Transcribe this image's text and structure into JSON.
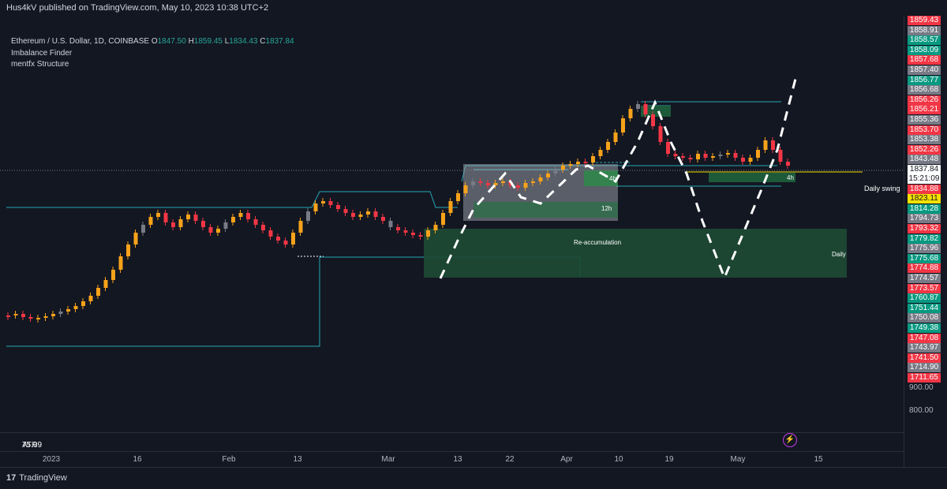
{
  "header": {
    "published": "Hus4kV published on TradingView.com, May 10, 2023 10:38 UTC+2"
  },
  "legend": {
    "symbol": "Ethereum / U.S. Dollar, 1D, COINBASE",
    "open_label": "O",
    "open": "1847.50",
    "high_label": "H",
    "high": "1859.45",
    "low_label": "L",
    "low": "1834.43",
    "close_label": "C",
    "close": "1837.84",
    "indicators": [
      "Imbalance Finder",
      "mentfx Structure"
    ]
  },
  "annotations": {
    "daily_swing": "Daily swing",
    "reaccumulation": "Re-accumulation",
    "tag_4h_a": "4h",
    "tag_4h_b": "4h",
    "tag_12h": "12h",
    "tag_daily": "Daily"
  },
  "price_axis": {
    "labels": [
      {
        "value": "1859.43",
        "color": "#f23645"
      },
      {
        "value": "1858.91",
        "color": "#787b86"
      },
      {
        "value": "1858.57",
        "color": "#089981"
      },
      {
        "value": "1858.09",
        "color": "#089981"
      },
      {
        "value": "1857.68",
        "color": "#f23645"
      },
      {
        "value": "1857.40",
        "color": "#787b86"
      },
      {
        "value": "1856.77",
        "color": "#089981"
      },
      {
        "value": "1856.68",
        "color": "#787b86"
      },
      {
        "value": "1856.26",
        "color": "#f23645"
      },
      {
        "value": "1856.21",
        "color": "#f23645"
      },
      {
        "value": "1855.36",
        "color": "#787b86"
      },
      {
        "value": "1853.70",
        "color": "#f23645"
      },
      {
        "value": "1853.38",
        "color": "#787b86"
      },
      {
        "value": "1852.26",
        "color": "#f23645"
      },
      {
        "value": "1843.48",
        "color": "#787b86"
      },
      {
        "value": "1837.84",
        "color": "#ffffff"
      },
      {
        "value": "15:21:09",
        "color": "#ffffff"
      },
      {
        "value": "1834.88",
        "color": "#f23645"
      },
      {
        "value": "1823.11",
        "color": "#f5e100"
      },
      {
        "value": "1814.28",
        "color": "#089981"
      },
      {
        "value": "1794.73",
        "color": "#787b86"
      },
      {
        "value": "1793.32",
        "color": "#f23645"
      },
      {
        "value": "1779.82",
        "color": "#089981"
      },
      {
        "value": "1775.96",
        "color": "#787b86"
      },
      {
        "value": "1775.68",
        "color": "#089981"
      },
      {
        "value": "1774.88",
        "color": "#f23645"
      },
      {
        "value": "1774.57",
        "color": "#787b86"
      },
      {
        "value": "1773.57",
        "color": "#f23645"
      },
      {
        "value": "1760.87",
        "color": "#089981"
      },
      {
        "value": "1751.44",
        "color": "#089981"
      },
      {
        "value": "1750.08",
        "color": "#787b86"
      },
      {
        "value": "1749.38",
        "color": "#089981"
      },
      {
        "value": "1747.08",
        "color": "#f23645"
      },
      {
        "value": "1743.97",
        "color": "#787b86"
      },
      {
        "value": "1741.50",
        "color": "#f23645"
      },
      {
        "value": "1714.90",
        "color": "#787b86"
      },
      {
        "value": "1711.65",
        "color": "#f23645"
      }
    ],
    "plain_labels": [
      "900.00",
      "800.00"
    ]
  },
  "atr": {
    "label": "ATR",
    "value": "75.09"
  },
  "time_axis": [
    {
      "label": "2023"
    },
    {
      "label": "16"
    },
    {
      "label": "Feb"
    },
    {
      "label": "13"
    },
    {
      "label": "Mar"
    },
    {
      "label": "13"
    },
    {
      "label": "22"
    },
    {
      "label": "Apr"
    },
    {
      "label": "10"
    },
    {
      "label": "19"
    },
    {
      "label": "May"
    },
    {
      "label": "15"
    }
  ],
  "footer": {
    "brand": "TradingView"
  },
  "colors": {
    "bull": "#f7a21b",
    "bear": "#f23645",
    "grey": "#787b86",
    "zone": "#1e5e3c",
    "line": "#26a7b3"
  }
}
